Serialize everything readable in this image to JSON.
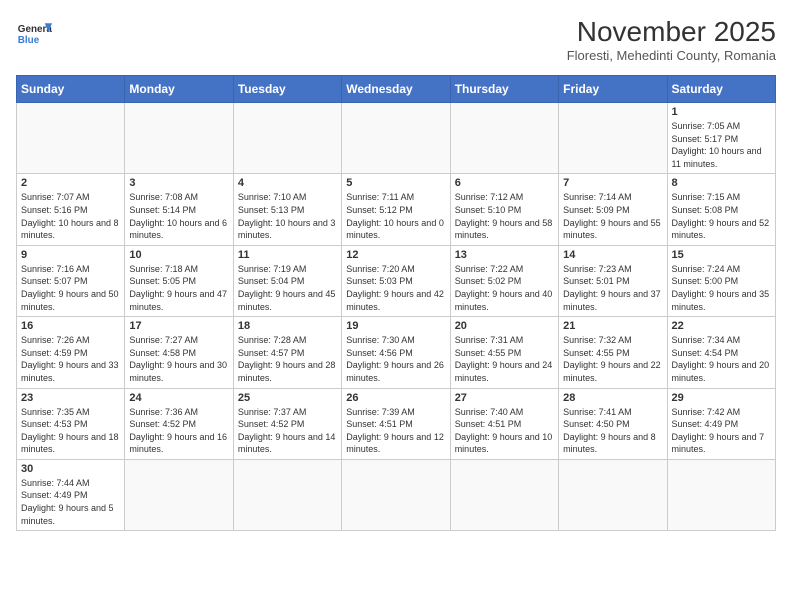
{
  "header": {
    "logo_general": "General",
    "logo_blue": "Blue",
    "month_year": "November 2025",
    "location": "Floresti, Mehedinti County, Romania"
  },
  "days_of_week": [
    "Sunday",
    "Monday",
    "Tuesday",
    "Wednesday",
    "Thursday",
    "Friday",
    "Saturday"
  ],
  "weeks": [
    [
      {
        "day": "",
        "info": ""
      },
      {
        "day": "",
        "info": ""
      },
      {
        "day": "",
        "info": ""
      },
      {
        "day": "",
        "info": ""
      },
      {
        "day": "",
        "info": ""
      },
      {
        "day": "",
        "info": ""
      },
      {
        "day": "1",
        "info": "Sunrise: 7:05 AM\nSunset: 5:17 PM\nDaylight: 10 hours and 11 minutes."
      }
    ],
    [
      {
        "day": "2",
        "info": "Sunrise: 7:07 AM\nSunset: 5:16 PM\nDaylight: 10 hours and 8 minutes."
      },
      {
        "day": "3",
        "info": "Sunrise: 7:08 AM\nSunset: 5:14 PM\nDaylight: 10 hours and 6 minutes."
      },
      {
        "day": "4",
        "info": "Sunrise: 7:10 AM\nSunset: 5:13 PM\nDaylight: 10 hours and 3 minutes."
      },
      {
        "day": "5",
        "info": "Sunrise: 7:11 AM\nSunset: 5:12 PM\nDaylight: 10 hours and 0 minutes."
      },
      {
        "day": "6",
        "info": "Sunrise: 7:12 AM\nSunset: 5:10 PM\nDaylight: 9 hours and 58 minutes."
      },
      {
        "day": "7",
        "info": "Sunrise: 7:14 AM\nSunset: 5:09 PM\nDaylight: 9 hours and 55 minutes."
      },
      {
        "day": "8",
        "info": "Sunrise: 7:15 AM\nSunset: 5:08 PM\nDaylight: 9 hours and 52 minutes."
      }
    ],
    [
      {
        "day": "9",
        "info": "Sunrise: 7:16 AM\nSunset: 5:07 PM\nDaylight: 9 hours and 50 minutes."
      },
      {
        "day": "10",
        "info": "Sunrise: 7:18 AM\nSunset: 5:05 PM\nDaylight: 9 hours and 47 minutes."
      },
      {
        "day": "11",
        "info": "Sunrise: 7:19 AM\nSunset: 5:04 PM\nDaylight: 9 hours and 45 minutes."
      },
      {
        "day": "12",
        "info": "Sunrise: 7:20 AM\nSunset: 5:03 PM\nDaylight: 9 hours and 42 minutes."
      },
      {
        "day": "13",
        "info": "Sunrise: 7:22 AM\nSunset: 5:02 PM\nDaylight: 9 hours and 40 minutes."
      },
      {
        "day": "14",
        "info": "Sunrise: 7:23 AM\nSunset: 5:01 PM\nDaylight: 9 hours and 37 minutes."
      },
      {
        "day": "15",
        "info": "Sunrise: 7:24 AM\nSunset: 5:00 PM\nDaylight: 9 hours and 35 minutes."
      }
    ],
    [
      {
        "day": "16",
        "info": "Sunrise: 7:26 AM\nSunset: 4:59 PM\nDaylight: 9 hours and 33 minutes."
      },
      {
        "day": "17",
        "info": "Sunrise: 7:27 AM\nSunset: 4:58 PM\nDaylight: 9 hours and 30 minutes."
      },
      {
        "day": "18",
        "info": "Sunrise: 7:28 AM\nSunset: 4:57 PM\nDaylight: 9 hours and 28 minutes."
      },
      {
        "day": "19",
        "info": "Sunrise: 7:30 AM\nSunset: 4:56 PM\nDaylight: 9 hours and 26 minutes."
      },
      {
        "day": "20",
        "info": "Sunrise: 7:31 AM\nSunset: 4:55 PM\nDaylight: 9 hours and 24 minutes."
      },
      {
        "day": "21",
        "info": "Sunrise: 7:32 AM\nSunset: 4:55 PM\nDaylight: 9 hours and 22 minutes."
      },
      {
        "day": "22",
        "info": "Sunrise: 7:34 AM\nSunset: 4:54 PM\nDaylight: 9 hours and 20 minutes."
      }
    ],
    [
      {
        "day": "23",
        "info": "Sunrise: 7:35 AM\nSunset: 4:53 PM\nDaylight: 9 hours and 18 minutes."
      },
      {
        "day": "24",
        "info": "Sunrise: 7:36 AM\nSunset: 4:52 PM\nDaylight: 9 hours and 16 minutes."
      },
      {
        "day": "25",
        "info": "Sunrise: 7:37 AM\nSunset: 4:52 PM\nDaylight: 9 hours and 14 minutes."
      },
      {
        "day": "26",
        "info": "Sunrise: 7:39 AM\nSunset: 4:51 PM\nDaylight: 9 hours and 12 minutes."
      },
      {
        "day": "27",
        "info": "Sunrise: 7:40 AM\nSunset: 4:51 PM\nDaylight: 9 hours and 10 minutes."
      },
      {
        "day": "28",
        "info": "Sunrise: 7:41 AM\nSunset: 4:50 PM\nDaylight: 9 hours and 8 minutes."
      },
      {
        "day": "29",
        "info": "Sunrise: 7:42 AM\nSunset: 4:49 PM\nDaylight: 9 hours and 7 minutes."
      }
    ],
    [
      {
        "day": "30",
        "info": "Sunrise: 7:44 AM\nSunset: 4:49 PM\nDaylight: 9 hours and 5 minutes."
      },
      {
        "day": "",
        "info": ""
      },
      {
        "day": "",
        "info": ""
      },
      {
        "day": "",
        "info": ""
      },
      {
        "day": "",
        "info": ""
      },
      {
        "day": "",
        "info": ""
      },
      {
        "day": "",
        "info": ""
      }
    ]
  ]
}
